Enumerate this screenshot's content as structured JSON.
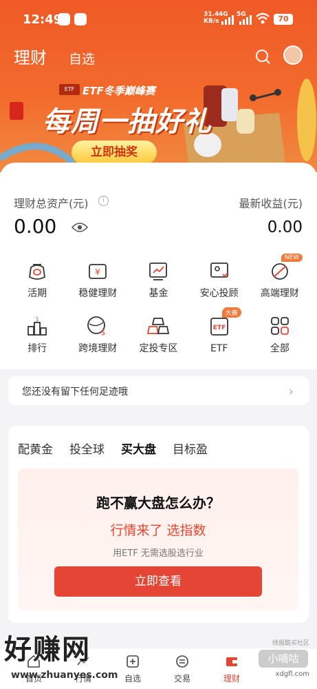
{
  "status_bar": {
    "time": "12:49",
    "speed_value": "31.4",
    "speed_unit": "KB/s",
    "net1": "4G",
    "net2": "5G",
    "battery": "70"
  },
  "header": {
    "title": "理财",
    "tab": "自选"
  },
  "banner": {
    "brand": "ETF",
    "subtitle": "ETF冬季巅峰赛",
    "headline": "每周一抽好礼",
    "button": "立即抽奖"
  },
  "assets": {
    "total_label": "理财总资产(元)",
    "total_value": "0.00",
    "earnings_label": "最新收益(元)",
    "earnings_value": "0.00"
  },
  "menu": [
    {
      "label": "活期",
      "icon": "piggy-icon"
    },
    {
      "label": "稳健理财",
      "icon": "yen-wallet-icon"
    },
    {
      "label": "基金",
      "icon": "chart-icon"
    },
    {
      "label": "安心投顾",
      "icon": "advisor-icon"
    },
    {
      "label": "高端理财",
      "icon": "premium-icon",
      "badge": "NEW"
    },
    {
      "label": "排行",
      "icon": "ranking-icon"
    },
    {
      "label": "跨境理财",
      "icon": "globe-dollar-icon"
    },
    {
      "label": "定投专区",
      "icon": "gold-bars-icon"
    },
    {
      "label": "ETF",
      "icon": "etf-icon",
      "badge": "大赛"
    },
    {
      "label": "全部",
      "icon": "grid-icon"
    }
  ],
  "footprint": {
    "text": "您还没有留下任何足迹哦"
  },
  "panel": {
    "tabs": [
      "配黄金",
      "投全球",
      "买大盘",
      "目标盈"
    ],
    "active_tab": "买大盘",
    "question": "跑不赢大盘怎么办？",
    "answer": "行情来了 选指数",
    "sub": "用ETF 无需选股选行业",
    "button": "立即查看"
  },
  "tabbar": [
    "首页",
    "行情",
    "自选",
    "交易",
    "理财"
  ],
  "tabbar_active": "理财",
  "watermark": {
    "main": "好赚网",
    "url": "www.zhuanyes.com",
    "right_top": "线报酷买社区",
    "right_mid": "小嘀咕",
    "right_bottom": "xdgfl.com"
  },
  "colors": {
    "primary": "#ef5a26",
    "accent_red": "#e44535"
  }
}
